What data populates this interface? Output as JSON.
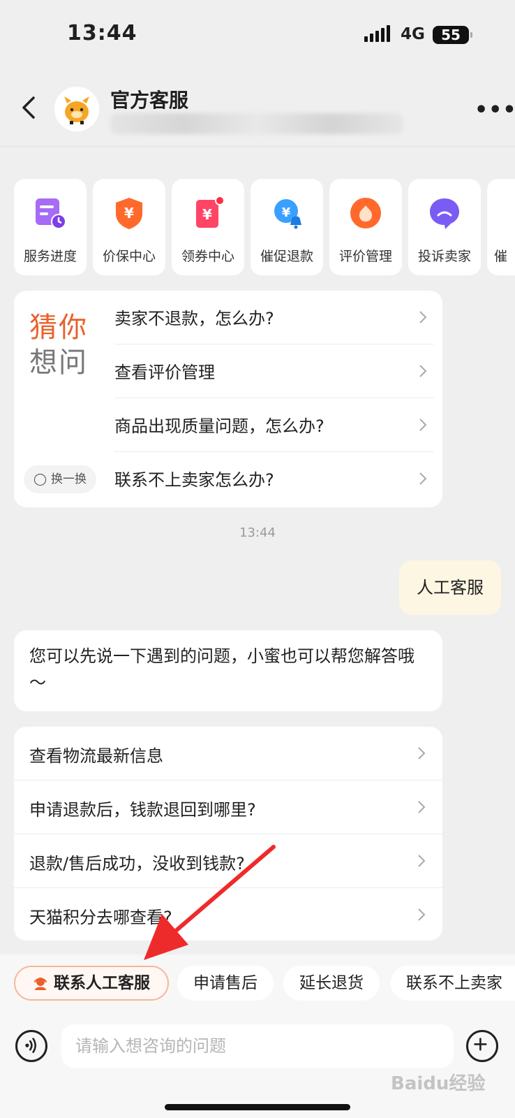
{
  "status": {
    "time": "13:44",
    "network": "4G",
    "battery": "55"
  },
  "header": {
    "title": "官方客服"
  },
  "quick_actions": [
    {
      "label": "服务进度",
      "icon": "service-progress-icon",
      "color": "#9b5cf5"
    },
    {
      "label": "价保中心",
      "icon": "price-protect-icon",
      "color": "#ff6a2c"
    },
    {
      "label": "领券中心",
      "icon": "coupon-icon",
      "color": "#ff4466"
    },
    {
      "label": "催促退款",
      "icon": "urge-refund-icon",
      "color": "#3aa0ff"
    },
    {
      "label": "评价管理",
      "icon": "review-manage-icon",
      "color": "#ff6a2c"
    },
    {
      "label": "投诉卖家",
      "icon": "complaint-icon",
      "color": "#6b5cf5"
    },
    {
      "label": "催",
      "icon": "urge-icon",
      "color": "#888888"
    }
  ],
  "guess": {
    "title_line1": "猜你",
    "title_line2": "想问",
    "swap_label": "换一换",
    "questions": [
      "卖家不退款，怎么办?",
      "查看评价管理",
      "商品出现质量问题，怎么办?",
      "联系不上卖家怎么办?"
    ]
  },
  "chat": {
    "timestamp": "13:44",
    "user_message": "人工客服",
    "bot_message": "您可以先说一下遇到的问题，小蜜也可以帮您解答哦～",
    "faq": [
      "查看物流最新信息",
      "申请退款后，钱款退回到哪里?",
      "退款/售后成功，没收到钱款?",
      "天猫积分去哪查看?"
    ]
  },
  "chips": [
    "联系人工客服",
    "申请售后",
    "延长退货",
    "联系不上卖家"
  ],
  "input": {
    "placeholder": "请输入想咨询的问题"
  },
  "watermark": "Baidu经验",
  "colors": {
    "accent": "#e8622c",
    "arrow": "#ee2b2b"
  }
}
